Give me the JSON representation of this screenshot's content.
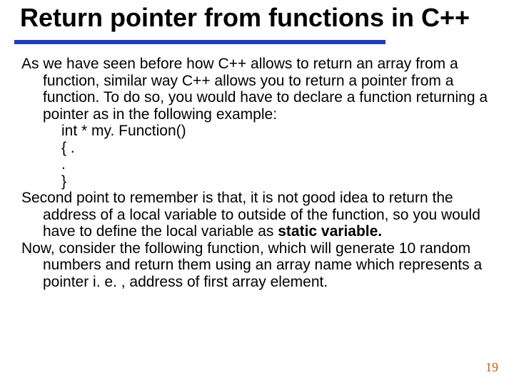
{
  "title": "Return pointer from functions in C++",
  "body": {
    "p1": "As we have seen before how C++ allows to return an array from a function, similar way C++ allows you to return a pointer from a function. To do so, you would have to declare a function returning a pointer as in the following example:",
    "code1": "int * my. Function()",
    "code2": "{ .",
    "code3": ".",
    "code4": "}",
    "p2a": "Second point to remember is that, it is not good idea to return the address of a local variable to outside of the function, so you would have to define the local variable as ",
    "p2b": "static variable.",
    "p3": "Now, consider the following function, which will generate 10 random numbers and return them using an array name which represents a pointer i. e. , address of first array element."
  },
  "page_number": "19"
}
